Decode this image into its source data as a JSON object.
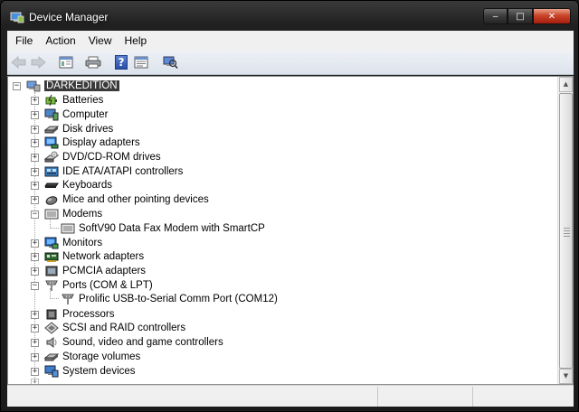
{
  "window": {
    "title": "Device Manager",
    "controls": {
      "minimize": "‒",
      "maximize": "□",
      "close": "✕"
    }
  },
  "menubar": {
    "items": [
      "File",
      "Action",
      "View",
      "Help"
    ]
  },
  "toolbar": {
    "buttons": [
      {
        "icon": "back-arrow-icon",
        "enabled": false
      },
      {
        "icon": "forward-arrow-icon",
        "enabled": false
      },
      {
        "icon": "properties-pane-icon"
      },
      {
        "icon": "printer-icon"
      },
      {
        "icon": "help-icon"
      },
      {
        "icon": "properties-icon"
      },
      {
        "icon": "scan-hardware-icon"
      }
    ],
    "help_glyph": "?"
  },
  "tree": {
    "root": {
      "label": "DARKEDITION",
      "expanded": true,
      "selected": true
    },
    "nodes": [
      {
        "label": "Batteries",
        "icon": "battery-icon",
        "expanded": false
      },
      {
        "label": "Computer",
        "icon": "computer-icon",
        "expanded": false
      },
      {
        "label": "Disk drives",
        "icon": "disk-drive-icon",
        "expanded": false
      },
      {
        "label": "Display adapters",
        "icon": "display-adapter-icon",
        "expanded": false
      },
      {
        "label": "DVD/CD-ROM drives",
        "icon": "dvd-drive-icon",
        "expanded": false
      },
      {
        "label": "IDE ATA/ATAPI controllers",
        "icon": "ide-controller-icon",
        "expanded": false
      },
      {
        "label": "Keyboards",
        "icon": "keyboard-icon",
        "expanded": false
      },
      {
        "label": "Mice and other pointing devices",
        "icon": "mouse-icon",
        "expanded": false
      },
      {
        "label": "Modems",
        "icon": "modem-icon",
        "expanded": true,
        "children": [
          {
            "label": "SoftV90 Data Fax Modem with SmartCP",
            "icon": "modem-icon"
          }
        ]
      },
      {
        "label": "Monitors",
        "icon": "monitor-icon",
        "expanded": false
      },
      {
        "label": "Network adapters",
        "icon": "network-adapter-icon",
        "expanded": false
      },
      {
        "label": "PCMCIA adapters",
        "icon": "pcmcia-icon",
        "expanded": false
      },
      {
        "label": "Ports (COM & LPT)",
        "icon": "port-icon",
        "expanded": true,
        "children": [
          {
            "label": "Prolific USB-to-Serial Comm Port (COM12)",
            "icon": "port-icon"
          }
        ]
      },
      {
        "label": "Processors",
        "icon": "processor-icon",
        "expanded": false
      },
      {
        "label": "SCSI and RAID controllers",
        "icon": "scsi-icon",
        "expanded": false
      },
      {
        "label": "Sound, video and game controllers",
        "icon": "speaker-icon",
        "expanded": false
      },
      {
        "label": "Storage volumes",
        "icon": "storage-volume-icon",
        "expanded": false
      },
      {
        "label": "System devices",
        "icon": "system-device-icon",
        "expanded": false
      }
    ],
    "expander_collapsed": "+",
    "expander_expanded": "−"
  },
  "scrollbar": {
    "up": "▲",
    "down": "▼"
  },
  "colors": {
    "titlebar": "#1b1b1b",
    "selection": "#3a3a3a",
    "close_button": "#c9452a"
  }
}
